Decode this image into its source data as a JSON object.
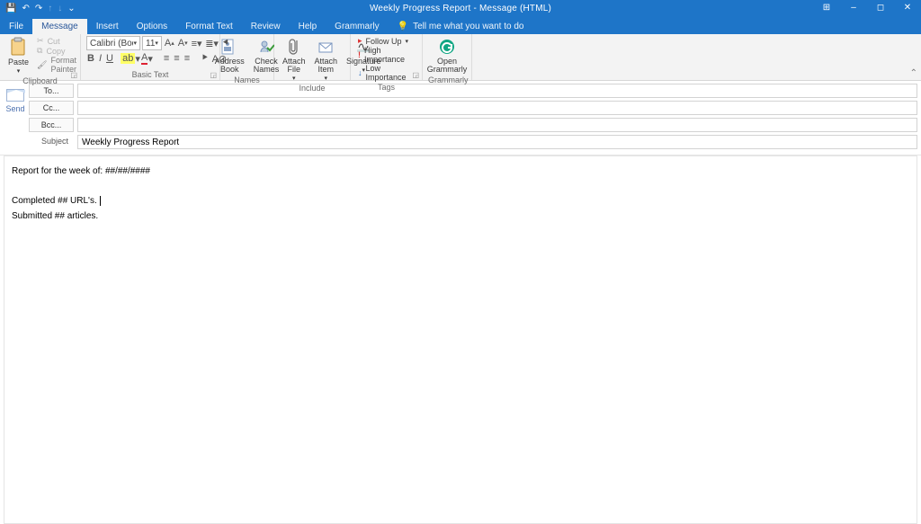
{
  "window": {
    "title": "Weekly Progress Report - Message (HTML)"
  },
  "qat": {
    "save": "💾",
    "undo": "↶",
    "redo": "↷",
    "up": "↑",
    "down": "↓",
    "more": "⌄"
  },
  "winctl": {
    "options": "⊞",
    "min": "–",
    "max": "◻",
    "close": "✕"
  },
  "tabs": {
    "file": "File",
    "message": "Message",
    "insert": "Insert",
    "options": "Options",
    "formattext": "Format Text",
    "review": "Review",
    "help": "Help",
    "grammarly": "Grammarly",
    "tell": "Tell me what you want to do"
  },
  "ribbon": {
    "clipboard": {
      "paste": "Paste",
      "cut": "Cut",
      "copy": "Copy",
      "painter": "Format Painter",
      "label": "Clipboard"
    },
    "basic": {
      "font": "Calibri (Bod",
      "size": "11",
      "label": "Basic Text"
    },
    "names": {
      "addressbook": "Address\nBook",
      "checknames": "Check\nNames",
      "label": "Names"
    },
    "include": {
      "attachfile": "Attach\nFile",
      "attachitem": "Attach\nItem",
      "signature": "Signature",
      "label": "Include"
    },
    "tags": {
      "followup": "Follow Up",
      "high": "High Importance",
      "low": "Low Importance",
      "label": "Tags"
    },
    "grammarly": {
      "open": "Open\nGrammarly",
      "label": "Grammarly"
    }
  },
  "compose": {
    "send": "Send",
    "to_label": "To...",
    "cc_label": "Cc...",
    "bcc_label": "Bcc...",
    "subject_label": "Subject",
    "to": "",
    "cc": "",
    "bcc": "",
    "subject": "Weekly Progress Report"
  },
  "body": {
    "line1": "Report for the week of:  ##/##/####",
    "line2": "Completed ## URL's.",
    "line3": "Submitted ## articles."
  },
  "icons": {
    "bullets": "≡",
    "numbers": "≣",
    "indent": "⯈",
    "bold": "B",
    "italic": "I",
    "underline": "U",
    "clear": "⊘",
    "highlight": "🖉",
    "color": "A",
    "left": "≡",
    "center": "≡",
    "right": "≡",
    "increase": "A",
    "decrease": "a",
    "grow": "A",
    "shrink": "A",
    "flag": "▸",
    "exclaim": "!",
    "down": "↓",
    "bulb": "💡",
    "search": "🔍",
    "book": "📕",
    "check": "✔️",
    "clip": "📎",
    "item": "📧",
    "pen": "✎"
  }
}
